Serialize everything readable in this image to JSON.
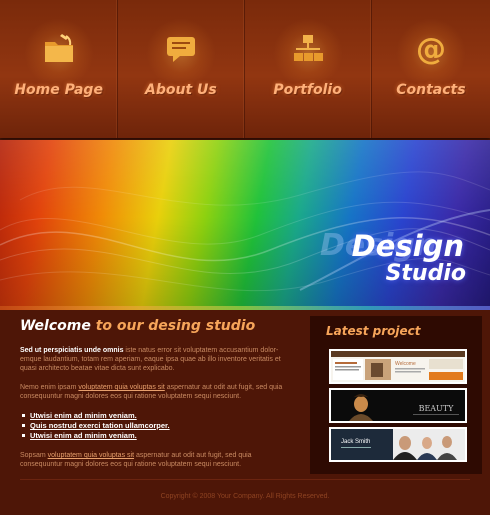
{
  "nav": {
    "items": [
      {
        "label": "Home Page",
        "icon": "folder-icon"
      },
      {
        "label": "About Us",
        "icon": "chat-bubble-icon"
      },
      {
        "label": "Portfolio",
        "icon": "sitemap-icon"
      },
      {
        "label": "Contacts",
        "icon": "at-sign-icon"
      }
    ]
  },
  "banner": {
    "brand_line1": "Design",
    "brand_line2": "Studio",
    "brand_echo": "Design"
  },
  "welcome": {
    "title_white": "Welcome",
    "title_orange": "to our desing studio",
    "p1_bold": "Sed ut perspiciatis unde omnis",
    "p1_rest": "iste natus error sit voluptatem accusantium dolor-emque laudantium, totam rem aperiam, eaque ipsa quae ab illo inventore veritatis et quasi architecto beatae vitae dicta sunt explicabo.",
    "p2_start": "Nemo enim ipsam",
    "p2_link": "voluptatem quia voluptas sit",
    "p2_rest": "aspernatur aut odit aut fugit, sed quia consequuntur magni dolores eos qui ratione voluptatem sequi nesciunt.",
    "links": [
      "Utwisi enim ad minim veniam.",
      "Quis nostrud exerci tation ullamcorper.",
      "Utwisi enim ad minim veniam."
    ],
    "p3_start": "Sopsam",
    "p3_link": "voluptatem quia voluptas sit",
    "p3_rest": "aspernatur aut odit aut fugit, sed quia consequuntur magni dolores eos qui ratione voluptatem sequi nesciunt."
  },
  "latest": {
    "title": "Latest project",
    "thumb1_heading": "Welcome",
    "thumb2_text": "BEAUTY",
    "thumb3_text": "Jack Smith"
  },
  "footer": {
    "copyright": "Copyright © 2008 Your Company. All Rights Reserved."
  },
  "colors": {
    "nav_label": "#ffb07a",
    "accent_orange": "#f7a55a",
    "body_text": "#c98a62",
    "background": "#4e1607"
  }
}
